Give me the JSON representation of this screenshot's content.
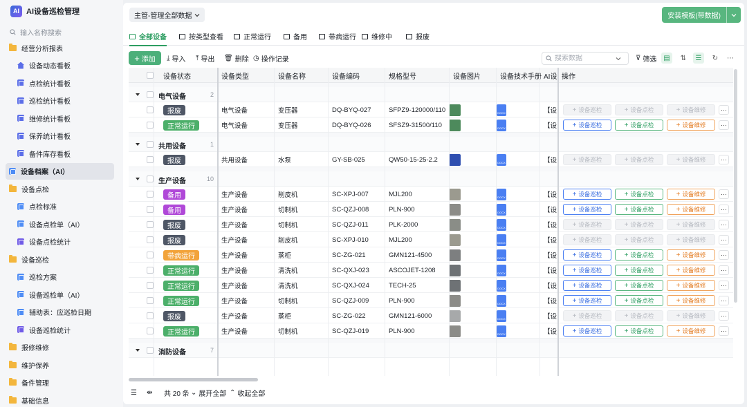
{
  "app": {
    "title": "AI设备巡检管理"
  },
  "sidebar": {
    "search_placeholder": "输入名称搜索",
    "items": [
      {
        "label": "经营分析报表",
        "level": "top",
        "icon": "folder-icon"
      },
      {
        "label": "设备动态看板",
        "level": "sub",
        "icon": "home-icon"
      },
      {
        "label": "点检统计看板",
        "level": "sub",
        "icon": "dashboard-icon"
      },
      {
        "label": "巡检统计看板",
        "level": "sub",
        "icon": "dashboard-icon"
      },
      {
        "label": "维修统计看板",
        "level": "sub",
        "icon": "dashboard-icon"
      },
      {
        "label": "保养统计看板",
        "level": "sub",
        "icon": "dashboard-icon"
      },
      {
        "label": "备件库存看板",
        "level": "sub",
        "icon": "dashboard-icon"
      },
      {
        "label": "设备档案（AI）",
        "level": "top",
        "icon": "table-icon",
        "active": true
      },
      {
        "label": "设备点检",
        "level": "top",
        "icon": "folder-icon"
      },
      {
        "label": "点检标准",
        "level": "sub",
        "icon": "table-icon"
      },
      {
        "label": "设备点检单（AI）",
        "level": "sub",
        "icon": "table-icon"
      },
      {
        "label": "设备点检统计",
        "level": "sub",
        "icon": "chart-icon"
      },
      {
        "label": "设备巡检",
        "level": "top",
        "icon": "folder-icon"
      },
      {
        "label": "巡检方案",
        "level": "sub",
        "icon": "table-icon"
      },
      {
        "label": "设备巡检单（AI）",
        "level": "sub",
        "icon": "table-icon"
      },
      {
        "label": "辅助表：应巡检日期",
        "level": "sub",
        "icon": "table-icon"
      },
      {
        "label": "设备巡检统计",
        "level": "sub",
        "icon": "chart-icon"
      },
      {
        "label": "报修维修",
        "level": "top",
        "icon": "folder-icon"
      },
      {
        "label": "维护保养",
        "level": "top",
        "icon": "folder-icon"
      },
      {
        "label": "备件管理",
        "level": "top",
        "icon": "folder-icon"
      },
      {
        "label": "基础信息",
        "level": "top",
        "icon": "folder-icon"
      }
    ]
  },
  "header": {
    "scope": "主管-管理全部数据",
    "install_label": "安装模板(带数据)"
  },
  "tabs": [
    "全部设备",
    "按类型查看",
    "正常运行",
    "备用",
    "带病运行",
    "维修中",
    "报废"
  ],
  "toolbar": {
    "add": "添加",
    "import": "导入",
    "export": "导出",
    "delete": "删除",
    "log": "操作记录",
    "search_placeholder": "搜索数据",
    "filter": "筛选"
  },
  "columns": [
    "设备状态",
    "设备类型",
    "设备名称",
    "设备编码",
    "规格型号",
    "设备图片",
    "设备技术手册",
    "AI设备",
    "操作"
  ],
  "actions": {
    "patrol": "设备巡检",
    "check": "设备点检",
    "repair": "设备维修",
    "more": "···"
  },
  "status_colors": {
    "报废": "#4f5766",
    "正常运行": "#4caf6a",
    "备用": "#b048d8",
    "带病运行": "#f2a33a"
  },
  "groups": [
    {
      "name": "电气设备",
      "count": "2",
      "rows": [
        {
          "status": "报废",
          "type": "电气设备",
          "name": "变压器",
          "code": "DQ-BYQ-027",
          "model": "SFPZ9-120000/110",
          "img": "#4d8a5c",
          "ai": "【设",
          "enabled": false
        },
        {
          "status": "正常运行",
          "type": "电气设备",
          "name": "变压器",
          "code": "DQ-BYQ-026",
          "model": "SFSZ9-31500/110",
          "img": "#4d8a5c",
          "ai": "【设",
          "enabled": true
        }
      ]
    },
    {
      "name": "共用设备",
      "count": "1",
      "rows": [
        {
          "status": "报废",
          "type": "共用设备",
          "name": "水泵",
          "code": "GY-SB-025",
          "model": "QW50-15-25-2.2",
          "img": "#2f4fb0",
          "ai": "【设",
          "enabled": false
        }
      ]
    },
    {
      "name": "生产设备",
      "count": "10",
      "rows": [
        {
          "status": "备用",
          "type": "生产设备",
          "name": "削皮机",
          "code": "SC-XPJ-007",
          "model": "MJL200",
          "img": "#9b9a8f",
          "ai": "【设",
          "enabled": true
        },
        {
          "status": "备用",
          "type": "生产设备",
          "name": "切制机",
          "code": "SC-QZJ-008",
          "model": "PLN-900",
          "img": "#8c8c88",
          "ai": "【设",
          "enabled": true
        },
        {
          "status": "报废",
          "type": "生产设备",
          "name": "切制机",
          "code": "SC-QZJ-011",
          "model": "PLK-2000",
          "img": "#8a8d87",
          "ai": "【设",
          "enabled": false
        },
        {
          "status": "报废",
          "type": "生产设备",
          "name": "削皮机",
          "code": "SC-XPJ-010",
          "model": "MJL200",
          "img": "#9b9a8f",
          "ai": "【设",
          "enabled": false
        },
        {
          "status": "带病运行",
          "type": "生产设备",
          "name": "蒸柜",
          "code": "SC-ZG-021",
          "model": "GMN121-4500",
          "img": "#7d7f80",
          "ai": "【设",
          "enabled": true
        },
        {
          "status": "正常运行",
          "type": "生产设备",
          "name": "清洗机",
          "code": "SC-QXJ-023",
          "model": "ASCOJET-1208",
          "img": "#6e7275",
          "ai": "【设",
          "enabled": true
        },
        {
          "status": "正常运行",
          "type": "生产设备",
          "name": "清洗机",
          "code": "SC-QXJ-024",
          "model": "TECH-25",
          "img": "#6e7275",
          "ai": "【设",
          "enabled": true
        },
        {
          "status": "正常运行",
          "type": "生产设备",
          "name": "切制机",
          "code": "SC-QZJ-009",
          "model": "PLN-900",
          "img": "#8c8c88",
          "ai": "【设",
          "enabled": true
        },
        {
          "status": "报废",
          "type": "生产设备",
          "name": "蒸柜",
          "code": "SC-ZG-022",
          "model": "GMN121-6000",
          "img": "#a7a9aa",
          "ai": "【设",
          "enabled": false
        },
        {
          "status": "正常运行",
          "type": "生产设备",
          "name": "切制机",
          "code": "SC-QZJ-019",
          "model": "PLN-900",
          "img": "#8c8c88",
          "ai": "【设",
          "enabled": true
        }
      ]
    },
    {
      "name": "消防设备",
      "count": "7",
      "rows": []
    }
  ],
  "footer": {
    "total": "共 20 条",
    "expand": "展开全部",
    "collapse": "收起全部"
  }
}
